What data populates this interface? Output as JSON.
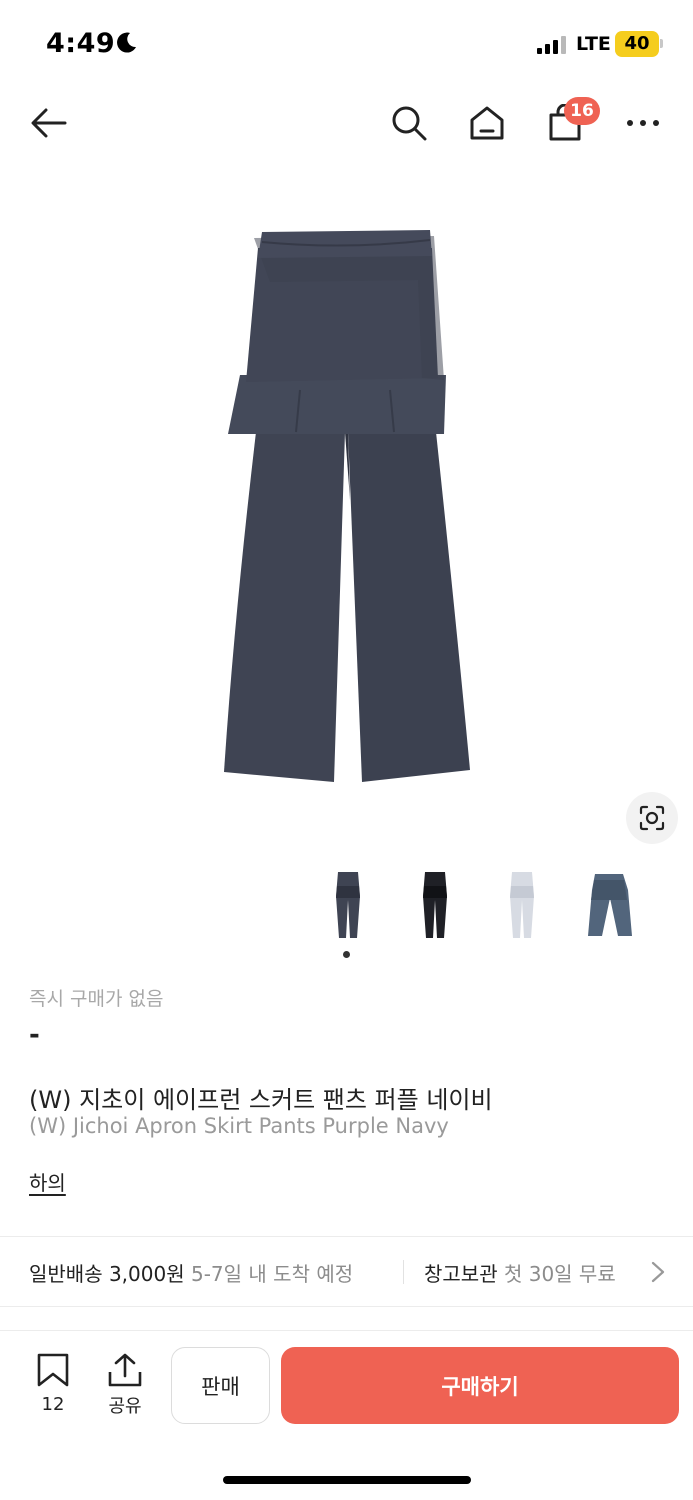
{
  "status_bar": {
    "time": "4:49",
    "network": "LTE",
    "battery": "40"
  },
  "nav": {
    "cart_badge": "16"
  },
  "thumbnails": [
    "navy",
    "black",
    "light-gray",
    "blue-gray"
  ],
  "product": {
    "instant_buy_label": "즉시 구매가 없음",
    "instant_buy_price": "-",
    "title_ko": "(W) 지초이 에이프런 스커트 팬츠 퍼플 네이비",
    "title_en": "(W) Jichoi Apron Skirt Pants Purple Navy",
    "category": "하의"
  },
  "delivery": {
    "type": "일반배송 3,000원",
    "eta": "5-7일 내 도착 예정",
    "storage_label": "창고보관",
    "storage_info": "첫 30일 무료"
  },
  "bottom_bar": {
    "bookmark_count": "12",
    "share_label": "공유",
    "sell_label": "판매",
    "buy_label": "구매하기"
  },
  "colors": {
    "accent": "#ef6253",
    "battery": "#f5cd1e",
    "garment_navy": "#3f4453"
  }
}
